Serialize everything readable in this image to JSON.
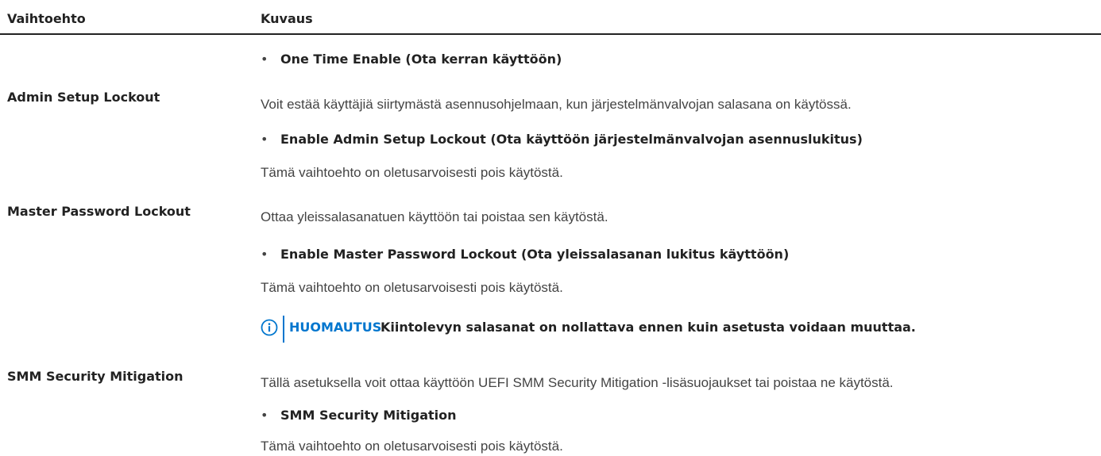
{
  "table": {
    "headers": {
      "option": "Vaihtoehto",
      "description": "Kuvaus"
    },
    "rows": [
      {
        "bullets": [
          "One Time Enable (Ota kerran käyttöön)"
        ]
      },
      {
        "option": "Admin Setup Lockout",
        "description": "Voit estää käyttäjiä siirtymästä asennusohjelmaan, kun järjestelmänvalvojan salasana on käytössä.",
        "bullets": [
          "Enable Admin Setup Lockout (Ota käyttöön järjestelmänvalvojan asennuslukitus)"
        ],
        "default_note": "Tämä vaihtoehto on oletusarvoisesti pois käytöstä."
      },
      {
        "option": "Master Password Lockout",
        "description": "Ottaa yleissalasanatuen käyttöön tai poistaa sen käytöstä.",
        "bullets": [
          "Enable Master Password Lockout (Ota yleissalasanan lukitus käyttöön)"
        ],
        "default_note": "Tämä vaihtoehto on oletusarvoisesti pois käytöstä.",
        "note": {
          "icon": "info-icon",
          "label": "HUOMAUTUS",
          "text": "Kiintolevyn salasanat on nollattava ennen kuin asetusta voidaan muuttaa.",
          "accent_color": "#0076ce"
        }
      },
      {
        "option": "SMM Security Mitigation",
        "description": "Tällä asetuksella voit ottaa käyttöön UEFI SMM Security Mitigation -lisäsuojaukset tai poistaa ne käytöstä.",
        "bullets": [
          "SMM Security Mitigation"
        ],
        "default_note": "Tämä vaihtoehto on oletusarvoisesti pois käytöstä."
      }
    ]
  }
}
